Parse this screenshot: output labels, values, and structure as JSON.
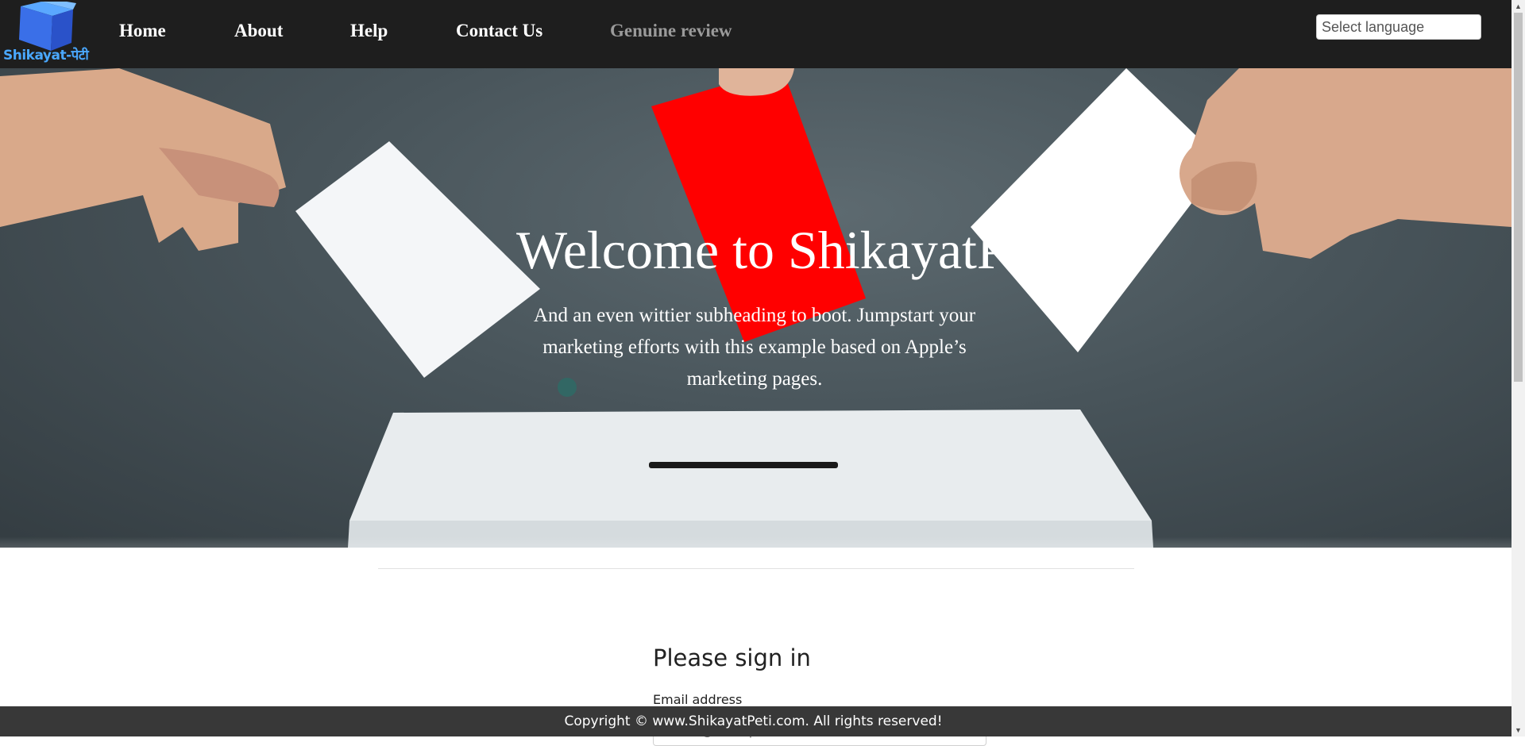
{
  "brand": {
    "logo_text": "Shikayat-पेटी"
  },
  "nav": {
    "links": [
      {
        "label": "Home"
      },
      {
        "label": "About"
      },
      {
        "label": "Help"
      },
      {
        "label": "Contact Us"
      },
      {
        "label": "Genuine review"
      }
    ],
    "language_placeholder": "Select language"
  },
  "hero": {
    "title": "Welcome to ShikayatP",
    "subtitle": "And an even wittier subheading to boot. Jumpstart your marketing efforts with this example based on Apple’s marketing pages."
  },
  "signin": {
    "title": "Please sign in",
    "email_label": "Email address",
    "email_placeholder": "name@example.com"
  },
  "footer": {
    "copyright": "Copyright © www.ShikayatPeti.com. All rights reserved!"
  },
  "colors": {
    "navbar": "#1e1e1e",
    "footer": "#383838",
    "accent_card": "#ff0000",
    "logo_blue": "#3b82f6"
  }
}
